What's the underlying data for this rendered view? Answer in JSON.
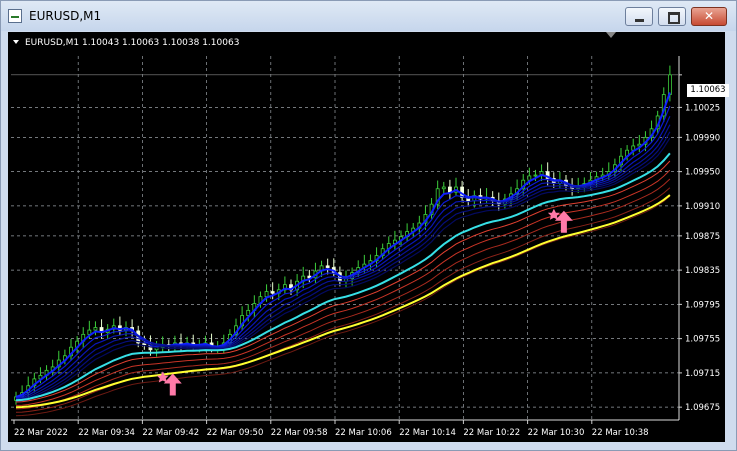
{
  "window": {
    "title": "EURUSD,M1"
  },
  "chart": {
    "header": "EURUSD,M1  1.10043 1.10063 1.10038 1.10063",
    "current_price": "1.10063"
  },
  "chart_data": {
    "type": "candlestick",
    "symbol": "EURUSD",
    "timeframe": "M1",
    "ohlc_header": {
      "open": 1.10043,
      "high": 1.10063,
      "low": 1.10038,
      "close": 1.10063
    },
    "ylim": [
      1.0966,
      1.10085
    ],
    "y_ticks": [
      "1.10063",
      "1.10025",
      "1.09990",
      "1.09950",
      "1.09910",
      "1.09875",
      "1.09835",
      "1.09795",
      "1.09755",
      "1.09715",
      "1.09675"
    ],
    "x_ticks": [
      "22 Mar 2022",
      "22 Mar 09:34",
      "22 Mar 09:42",
      "22 Mar 09:50",
      "22 Mar 09:58",
      "22 Mar 10:06",
      "22 Mar 10:14",
      "22 Mar 10:22",
      "22 Mar 10:30",
      "22 Mar 10:38"
    ],
    "grid": true,
    "candle_closes": [
      1.09687,
      1.09692,
      1.097,
      1.09708,
      1.09712,
      1.09718,
      1.09722,
      1.0973,
      1.09735,
      1.09745,
      1.09752,
      1.0976,
      1.09765,
      1.09768,
      1.09762,
      1.09766,
      1.0977,
      1.09765,
      1.09768,
      1.09764,
      1.0975,
      1.09748,
      1.09742,
      1.09745,
      1.09748,
      1.09746,
      1.0975,
      1.09748,
      1.0975,
      1.09746,
      1.09748,
      1.0975,
      1.09744,
      1.09745,
      1.0975,
      1.0976,
      1.0977,
      1.09782,
      1.09788,
      1.09796,
      1.09804,
      1.0981,
      1.09808,
      1.09812,
      1.09818,
      1.09812,
      1.09822,
      1.09828,
      1.09826,
      1.09834,
      1.0984,
      1.09838,
      1.09832,
      1.09822,
      1.09825,
      1.09832,
      1.09838,
      1.09842,
      1.09846,
      1.09852,
      1.0986,
      1.09866,
      1.0987,
      1.09874,
      1.0988,
      1.09884,
      1.0989,
      1.099,
      1.09912,
      1.0993,
      1.09932,
      1.09926,
      1.09932,
      1.0992,
      1.09916,
      1.09922,
      1.09918,
      1.0992,
      1.09916,
      1.09912,
      1.09918,
      1.09924,
      1.0993,
      1.0994,
      1.09945,
      1.09946,
      1.0995,
      1.09942,
      1.09936,
      1.0994,
      1.09934,
      1.0993,
      1.09932,
      1.09936,
      1.0994,
      1.09944,
      1.09946,
      1.0995,
      1.09958,
      1.09968,
      1.09975,
      1.0998,
      1.09982,
      1.0999,
      1.1,
      1.10015,
      1.1004,
      1.10063
    ],
    "series": [
      {
        "name": "",
        "color": "#0018c0",
        "role": "blue-ma-band"
      },
      {
        "name": "",
        "color": "#37e0e6",
        "role": "cyan-ma"
      },
      {
        "name": "",
        "color": "#c03020",
        "role": "red-ma-band"
      },
      {
        "name": "",
        "color": "#ffff30",
        "role": "yellow-ma"
      }
    ],
    "signals": [
      {
        "type": "buy-arrow",
        "time_index": 25,
        "price": 1.09705
      },
      {
        "type": "buy-arrow",
        "time_index": 89,
        "price": 1.09895
      }
    ],
    "colors": {
      "bull_wick": "#3ccf3c",
      "bull_body": "#000000",
      "bear_body": "#f5ffe0",
      "grid": "#9aa0a6",
      "arrow": "#ff7aa8"
    }
  }
}
